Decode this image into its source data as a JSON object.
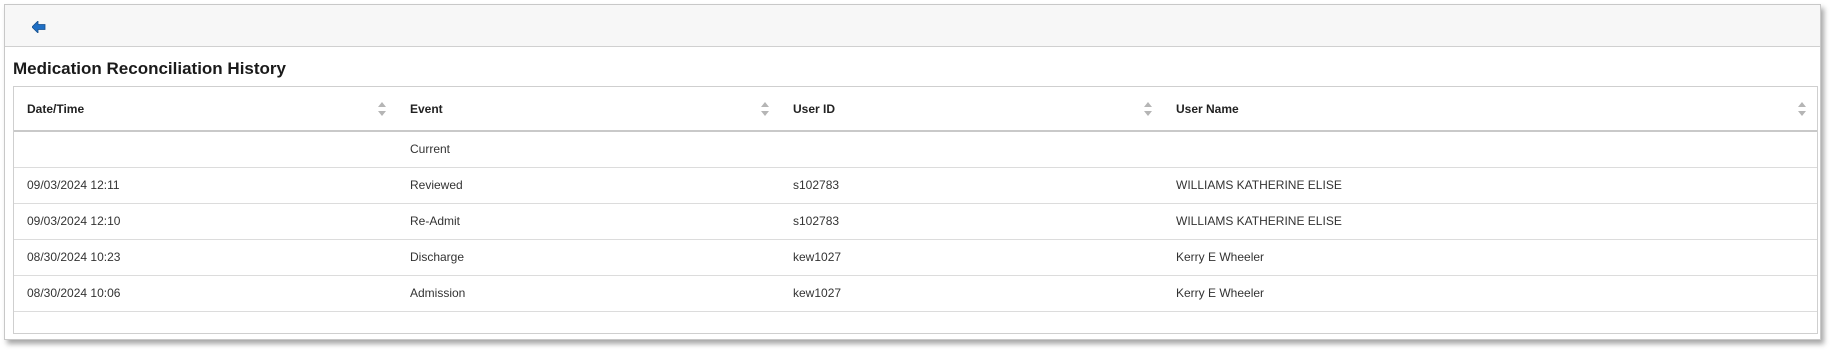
{
  "toolbar": {
    "back_icon": "back-arrow-icon",
    "back_color": "#1f6fc5"
  },
  "page": {
    "title": "Medication Reconciliation History"
  },
  "table": {
    "columns": [
      {
        "label": "Date/Time"
      },
      {
        "label": "Event"
      },
      {
        "label": "User ID"
      },
      {
        "label": "User Name"
      }
    ],
    "rows": [
      {
        "datetime": "",
        "event": "Current",
        "user_id": "",
        "user_name": ""
      },
      {
        "datetime": "09/03/2024 12:11",
        "event": "Reviewed",
        "user_id": "s102783",
        "user_name": "WILLIAMS KATHERINE ELISE"
      },
      {
        "datetime": "09/03/2024 12:10",
        "event": "Re-Admit",
        "user_id": "s102783",
        "user_name": "WILLIAMS KATHERINE ELISE"
      },
      {
        "datetime": "08/30/2024 10:23",
        "event": "Discharge",
        "user_id": "kew1027",
        "user_name": "Kerry E Wheeler"
      },
      {
        "datetime": "08/30/2024 10:06",
        "event": "Admission",
        "user_id": "kew1027",
        "user_name": "Kerry E Wheeler"
      }
    ]
  }
}
